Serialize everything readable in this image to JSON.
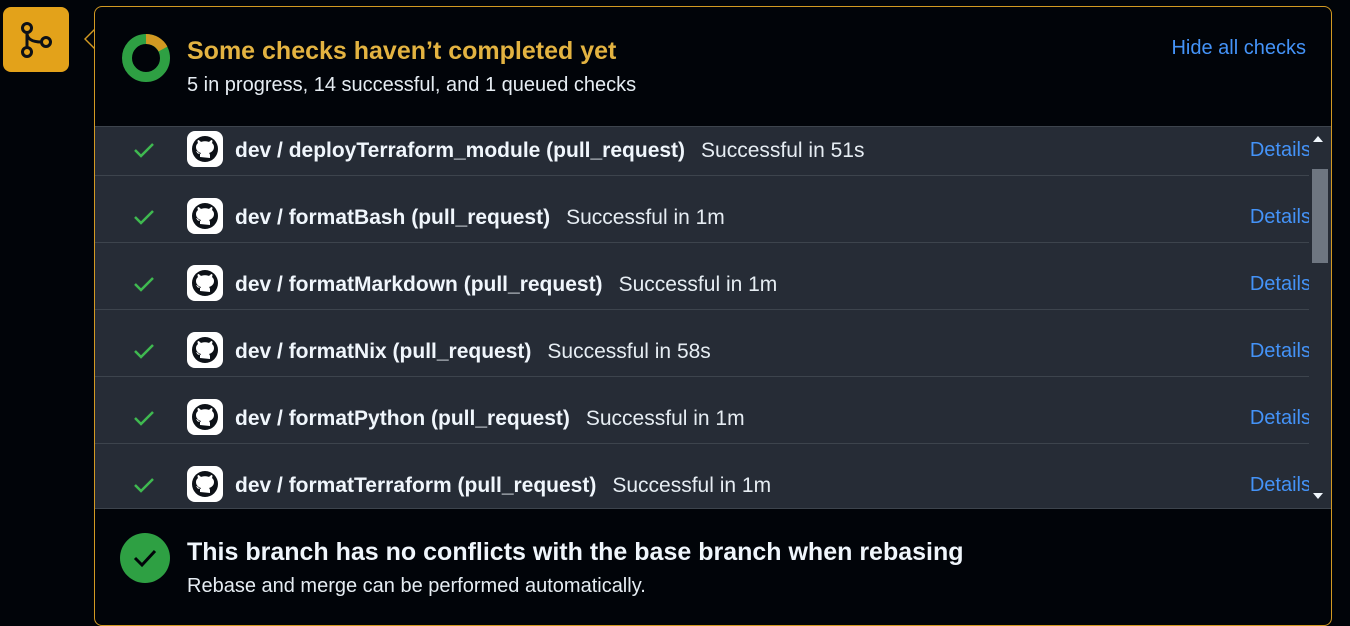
{
  "merge_icon": "git-branch-icon",
  "colors": {
    "accent": "#e3a21a",
    "title_warning": "#e3b341",
    "success": "#2ea043",
    "link": "#4493f8"
  },
  "checks": {
    "title": "Some checks haven’t completed yet",
    "summary": "5 in progress, 14 successful, and 1 queued checks",
    "hide_label": "Hide all checks",
    "items": [
      {
        "name": "dev / deployTerraform_module (pull_request)",
        "status": "Successful in 51s",
        "details": "Details"
      },
      {
        "name": "dev / formatBash (pull_request)",
        "status": "Successful in 1m",
        "details": "Details"
      },
      {
        "name": "dev / formatMarkdown (pull_request)",
        "status": "Successful in 1m",
        "details": "Details"
      },
      {
        "name": "dev / formatNix (pull_request)",
        "status": "Successful in 58s",
        "details": "Details"
      },
      {
        "name": "dev / formatPython (pull_request)",
        "status": "Successful in 1m",
        "details": "Details"
      },
      {
        "name": "dev / formatTerraform (pull_request)",
        "status": "Successful in 1m",
        "details": "Details"
      }
    ]
  },
  "merge_status": {
    "title": "This branch has no conflicts with the base branch when rebasing",
    "subtitle": "Rebase and merge can be performed automatically."
  }
}
